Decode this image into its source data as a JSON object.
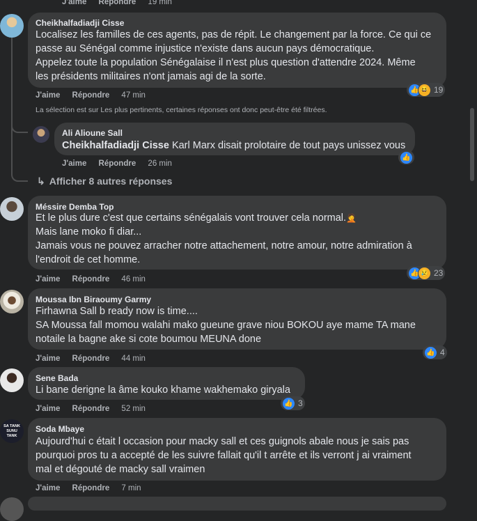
{
  "top_actions": {
    "like": "J'aime",
    "reply": "Répondre",
    "time": "19 min"
  },
  "comments": [
    {
      "author": "Cheikhalfadiadji Cisse",
      "lines": [
        "Localisez les familles de ces agents, pas de répit. Le changement par la force. Ce qui ce",
        "passe au Sénégal comme injustice n'existe dans aucun pays démocratique.",
        "Appelez toute la population Sénégalaise il n'est plus question d'attendre 2024. Même",
        "les présidents militaires n'ont jamais agi de la sorte."
      ],
      "like": "J'aime",
      "reply": "Répondre",
      "time": "47 min",
      "reactions": [
        "like-icon",
        "haha-icon"
      ],
      "count": "19"
    },
    {
      "author": "Méssire Demba Top",
      "lines": [
        "Et le plus dure c'est que certains sénégalais vont trouver cela normal.",
        "Mais lane moko fi diar...",
        "Jamais vous ne pouvez arracher notre attachement, notre amour, notre admiration à",
        "l'endroit de cet homme."
      ],
      "like": "J'aime",
      "reply": "Répondre",
      "time": "46 min",
      "reactions": [
        "like-icon",
        "sad-icon"
      ],
      "count": "23"
    },
    {
      "author": "Moussa Ibn Biraoumy Garmy",
      "lines": [
        "Firhawna Sall b ready now is time....",
        "SA Moussa fall momou walahi mako gueune grave niou BOKOU aye mame TA mane",
        "notaile la bagne ake si cote boumou MEUNA done"
      ],
      "like": "J'aime",
      "reply": "Répondre",
      "time": "44 min",
      "reactions": [
        "like-icon"
      ],
      "count": "4"
    },
    {
      "author": "Sene Bada",
      "lines": [
        "Li bane derigne la âme kouko khame wakhemako giryala"
      ],
      "like": "J'aime",
      "reply": "Répondre",
      "time": "52 min",
      "reactions": [
        "like-icon"
      ],
      "count": "3"
    },
    {
      "author": "Soda Mbaye",
      "lines": [
        "Aujourd'hui c était l occasion pour macky sall et ces guignols abale nous je sais pas",
        "pourquoi pros tu a accepté de les suivre fallait qu'il t arrête et ils verront j ai vraiment",
        "mal et dégouté de macky sall vraimen"
      ],
      "like": "J'aime",
      "reply": "Répondre",
      "time": "7 min"
    }
  ],
  "filter_notice": "La sélection est sur Les plus pertinents, certaines réponses ont donc peut-être été filtrées.",
  "reply": {
    "author": "Ali Alioune Sall",
    "mention": "Cheikhalfadiadji Cisse",
    "text": " Karl Marx disait prolotaire de tout pays unissez vous",
    "like": "J'aime",
    "reply": "Répondre",
    "time": "26 min",
    "reactions": [
      "like-icon"
    ]
  },
  "more_replies": "Afficher 8 autres réponses",
  "avatar_text": "SA TANK SUNU TANK",
  "colors": {
    "background": "#242526",
    "bubble": "#3a3b3c",
    "like": "#2d88ff",
    "haha": "#f7b125"
  }
}
